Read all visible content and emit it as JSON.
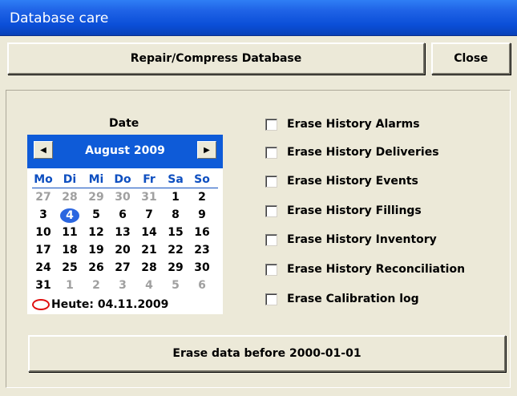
{
  "window": {
    "title": "Database care"
  },
  "toolbar": {
    "repair_label": "Repair/Compress Database",
    "close_label": "Close"
  },
  "date": {
    "label": "Date",
    "month_title": "August 2009",
    "prev": "◀",
    "next": "▶",
    "weekdays": [
      "Mo",
      "Di",
      "Mi",
      "Do",
      "Fr",
      "Sa",
      "So"
    ],
    "weeks": [
      [
        "27",
        "28",
        "29",
        "30",
        "31",
        "1",
        "2"
      ],
      [
        "3",
        "4",
        "5",
        "6",
        "7",
        "8",
        "9"
      ],
      [
        "10",
        "11",
        "12",
        "13",
        "14",
        "15",
        "16"
      ],
      [
        "17",
        "18",
        "19",
        "20",
        "21",
        "22",
        "23"
      ],
      [
        "24",
        "25",
        "26",
        "27",
        "28",
        "29",
        "30"
      ],
      [
        "31",
        "1",
        "2",
        "3",
        "4",
        "5",
        "6"
      ]
    ],
    "selected": "4",
    "today_text": "Heute: 04.11.2009"
  },
  "options": [
    {
      "label": "Erase History Alarms",
      "checked": false
    },
    {
      "label": "Erase History Deliveries",
      "checked": false
    },
    {
      "label": "Erase History Events",
      "checked": false
    },
    {
      "label": "Erase History Fillings",
      "checked": false
    },
    {
      "label": "Erase History Inventory",
      "checked": false
    },
    {
      "label": "Erase History Reconciliation",
      "checked": false
    },
    {
      "label": "Erase Calibration log",
      "checked": false
    }
  ],
  "erase_button": {
    "label": "Erase data before 2000-01-01"
  },
  "colors": {
    "title_bar": "#0b4fd8",
    "calendar_header": "#0e5bd8",
    "today_ring": "#e01010"
  }
}
